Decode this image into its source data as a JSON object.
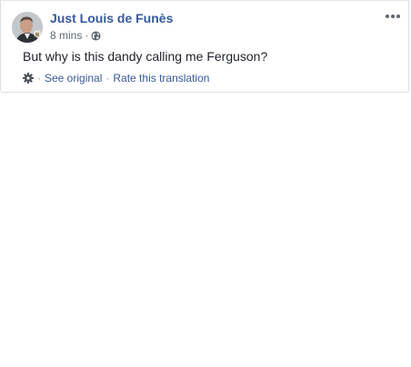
{
  "post": {
    "author_name": "Just Louis de Funès",
    "timestamp": "8 mins",
    "separator": "·",
    "privacy_icon": "globe-icon",
    "menu_icon": "more-horizontal-icon",
    "text": "But why is this dandy calling me Ferguson?",
    "translation": {
      "settings_icon": "gear-icon",
      "separator": "·",
      "see_original_label": "See original",
      "rate_translation_label": "Rate this translation"
    }
  },
  "colors": {
    "link_blue": "#365899",
    "meta_gray": "#616770",
    "text_dark": "#1d2129",
    "border": "#dddfe2"
  }
}
